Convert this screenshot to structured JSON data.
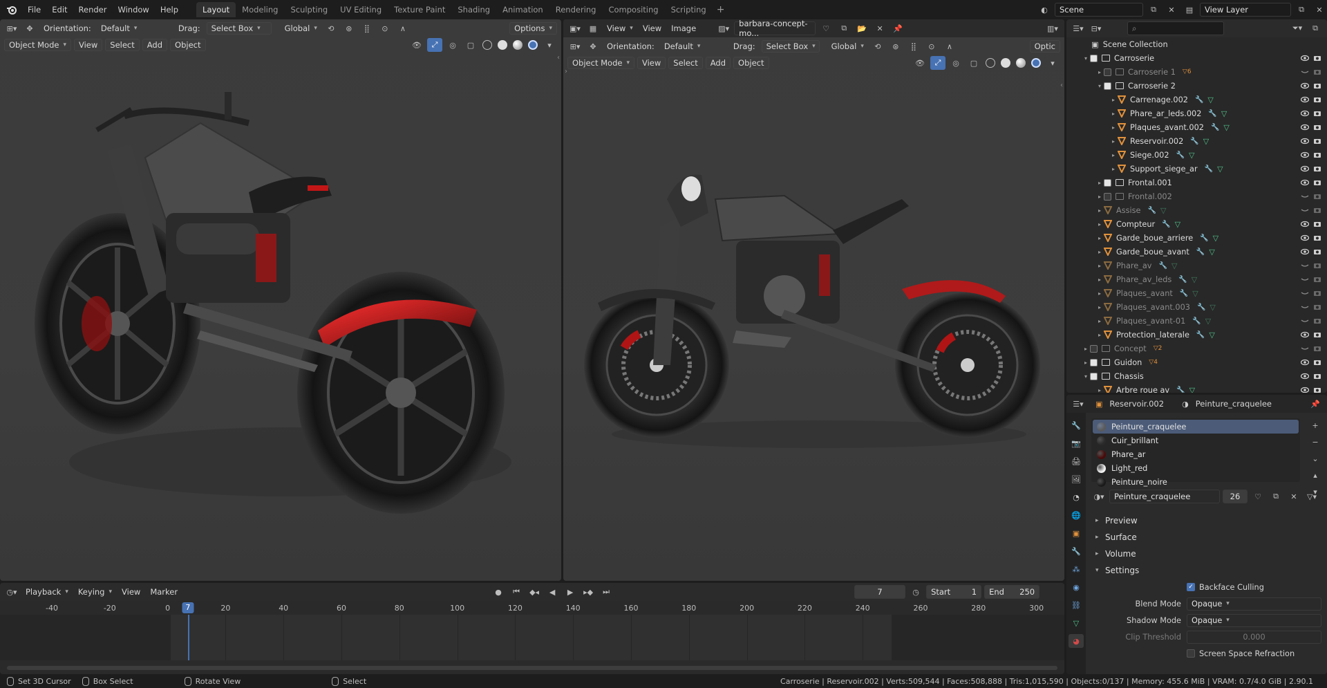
{
  "menu": {
    "file": "File",
    "edit": "Edit",
    "render": "Render",
    "window": "Window",
    "help": "Help"
  },
  "workspaces": [
    "Layout",
    "Modeling",
    "Sculpting",
    "UV Editing",
    "Texture Paint",
    "Shading",
    "Animation",
    "Rendering",
    "Compositing",
    "Scripting"
  ],
  "active_workspace": "Layout",
  "scene": {
    "name": "Scene",
    "view_layer": "View Layer"
  },
  "viewport_left": {
    "orientation_label": "Orientation:",
    "orientation": "Default",
    "drag_label": "Drag:",
    "drag": "Select Box",
    "transform": "Global",
    "options": "Options",
    "mode": "Object Mode",
    "menus": [
      "View",
      "Select",
      "Add",
      "Object"
    ]
  },
  "viewport_right": {
    "menus_top": [
      "View",
      "View",
      "Image"
    ],
    "image_name": "barbara-concept-mo...",
    "orientation_label": "Orientation:",
    "orientation": "Default",
    "drag_label": "Drag:",
    "drag": "Select Box",
    "transform": "Global",
    "options": "Optic",
    "mode": "Object Mode",
    "menus": [
      "View",
      "Select",
      "Add",
      "Object"
    ]
  },
  "outliner": {
    "title": "Scene Collection",
    "rows": [
      {
        "depth": 0,
        "type": "coll",
        "name": "Carroserie",
        "dim": false,
        "open": true,
        "vis": true
      },
      {
        "depth": 1,
        "type": "coll",
        "name": "Carroserie 1",
        "dim": true,
        "badge": "6",
        "vis": false
      },
      {
        "depth": 1,
        "type": "coll",
        "name": "Carroserie 2",
        "dim": false,
        "open": true,
        "vis": true
      },
      {
        "depth": 2,
        "type": "obj",
        "name": "Carrenage.002",
        "dim": false,
        "vis": true
      },
      {
        "depth": 2,
        "type": "obj",
        "name": "Phare_ar_leds.002",
        "dim": false,
        "vis": true
      },
      {
        "depth": 2,
        "type": "obj",
        "name": "Plaques_avant.002",
        "dim": false,
        "vis": true
      },
      {
        "depth": 2,
        "type": "obj",
        "name": "Reservoir.002",
        "dim": false,
        "vis": true
      },
      {
        "depth": 2,
        "type": "obj",
        "name": "Siege.002",
        "dim": false,
        "vis": true
      },
      {
        "depth": 2,
        "type": "obj",
        "name": "Support_siege_ar",
        "dim": false,
        "vis": true
      },
      {
        "depth": 1,
        "type": "coll",
        "name": "Frontal.001",
        "dim": false,
        "vis": true
      },
      {
        "depth": 1,
        "type": "coll",
        "name": "Frontal.002",
        "dim": true,
        "vis": false
      },
      {
        "depth": 1,
        "type": "obj",
        "name": "Assise",
        "dim": true,
        "vis": false
      },
      {
        "depth": 1,
        "type": "obj",
        "name": "Compteur",
        "dim": false,
        "vis": true
      },
      {
        "depth": 1,
        "type": "obj",
        "name": "Garde_boue_arriere",
        "dim": false,
        "vis": true
      },
      {
        "depth": 1,
        "type": "obj",
        "name": "Garde_boue_avant",
        "dim": false,
        "vis": true
      },
      {
        "depth": 1,
        "type": "obj",
        "name": "Phare_av",
        "dim": true,
        "vis": false
      },
      {
        "depth": 1,
        "type": "obj",
        "name": "Phare_av_leds",
        "dim": true,
        "vis": false
      },
      {
        "depth": 1,
        "type": "obj",
        "name": "Plaques_avant",
        "dim": true,
        "vis": false
      },
      {
        "depth": 1,
        "type": "obj",
        "name": "Plaques_avant.003",
        "dim": true,
        "vis": false
      },
      {
        "depth": 1,
        "type": "obj",
        "name": "Plaques_avant-01",
        "dim": true,
        "vis": false
      },
      {
        "depth": 1,
        "type": "obj",
        "name": "Protection_laterale",
        "dim": false,
        "vis": true
      },
      {
        "depth": 0,
        "type": "coll",
        "name": "Concept",
        "dim": true,
        "badge": "2",
        "vis": false
      },
      {
        "depth": 0,
        "type": "coll",
        "name": "Guidon",
        "dim": false,
        "badge": "4",
        "vis": true
      },
      {
        "depth": 0,
        "type": "coll",
        "name": "Chassis",
        "dim": false,
        "open": true,
        "vis": true
      },
      {
        "depth": 1,
        "type": "obj",
        "name": "Arbre roue av",
        "dim": false,
        "vis": true
      }
    ]
  },
  "properties": {
    "object": "Reservoir.002",
    "material": "Peinture_craquelee",
    "slots": [
      {
        "name": "Peinture_craquelee",
        "color": "#5a5a5a",
        "selected": true
      },
      {
        "name": "Cuir_brillant",
        "color": "#2a2a2a",
        "selected": false
      },
      {
        "name": "Phare_ar",
        "color": "#4a0a0a",
        "selected": false
      },
      {
        "name": "Light_red",
        "color": "#f2f2f2",
        "selected": false
      },
      {
        "name": "Peinture_noire",
        "color": "#1a1a1a",
        "selected": false
      }
    ],
    "material_field": "Peinture_craquelee",
    "users": "26",
    "sections": [
      "Preview",
      "Surface",
      "Volume",
      "Settings"
    ],
    "backface_culling": "Backface Culling",
    "blend_mode_label": "Blend Mode",
    "blend_mode": "Opaque",
    "shadow_mode_label": "Shadow Mode",
    "shadow_mode": "Opaque",
    "clip_label": "Clip Threshold",
    "clip_value": "0.000",
    "ssr": "Screen Space Refraction"
  },
  "timeline": {
    "menus": [
      "Playback",
      "Keying",
      "View",
      "Marker"
    ],
    "current_frame": "7",
    "start_label": "Start",
    "start": "1",
    "end_label": "End",
    "end": "250",
    "ticks": [
      "-40",
      "-20",
      "0",
      "20",
      "40",
      "60",
      "80",
      "100",
      "120",
      "140",
      "160",
      "180",
      "200",
      "220",
      "240",
      "260",
      "280",
      "300"
    ]
  },
  "status": {
    "left": "Set 3D Cursor",
    "box": "Box Select",
    "rotate": "Rotate View",
    "select": "Select",
    "info": "Carroserie | Reservoir.002 | Verts:509,544 | Faces:508,888 | Tris:1,015,590 | Objects:0/137 | Memory: 455.6 MiB | VRAM: 0.7/4.0 GiB | 2.90.1"
  },
  "colors": {
    "accent": "#4772b3",
    "selection": "#4b5b78",
    "playhead": "#4772b3",
    "object_orange": "#e0913c",
    "mesh_green": "#4fc28a"
  }
}
